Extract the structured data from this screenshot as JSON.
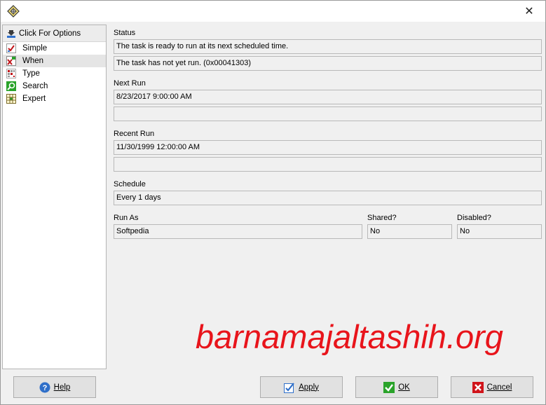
{
  "window": {
    "close_glyph": "✕"
  },
  "sidebar": {
    "header": {
      "label": "Click For Options",
      "icon": "download-arrow-icon"
    },
    "items": [
      {
        "label": "Simple",
        "icon": "checklist-icon"
      },
      {
        "label": "When",
        "icon": "calendar-x-icon"
      },
      {
        "label": "Type",
        "icon": "grid-dots-icon"
      },
      {
        "label": "Search",
        "icon": "magnifier-icon"
      },
      {
        "label": "Expert",
        "icon": "table-icon"
      }
    ]
  },
  "status": {
    "label": "Status",
    "line1": "The task is ready to run at its next scheduled time.",
    "line2": "The task has not yet run. (0x00041303)"
  },
  "next_run": {
    "label": "Next Run",
    "value": "8/23/2017 9:00:00 AM",
    "value2": ""
  },
  "recent_run": {
    "label": "Recent Run",
    "value": "11/30/1999 12:00:00 AM",
    "value2": ""
  },
  "schedule": {
    "label": "Schedule",
    "value": "Every 1 days"
  },
  "run_as": {
    "label": "Run As",
    "value": "Softpedia"
  },
  "shared": {
    "label": "Shared?",
    "value": "No"
  },
  "disabled": {
    "label": "Disabled?",
    "value": "No"
  },
  "watermark": "barnamajaltashih.org",
  "buttons": {
    "help": "Help",
    "apply": "Apply",
    "ok": "OK",
    "cancel": "Cancel"
  },
  "colors": {
    "watermark": "#e8141b",
    "help_icon": "#2f6fc9",
    "ok_icon": "#2aa32a",
    "cancel_icon": "#d0141a"
  }
}
